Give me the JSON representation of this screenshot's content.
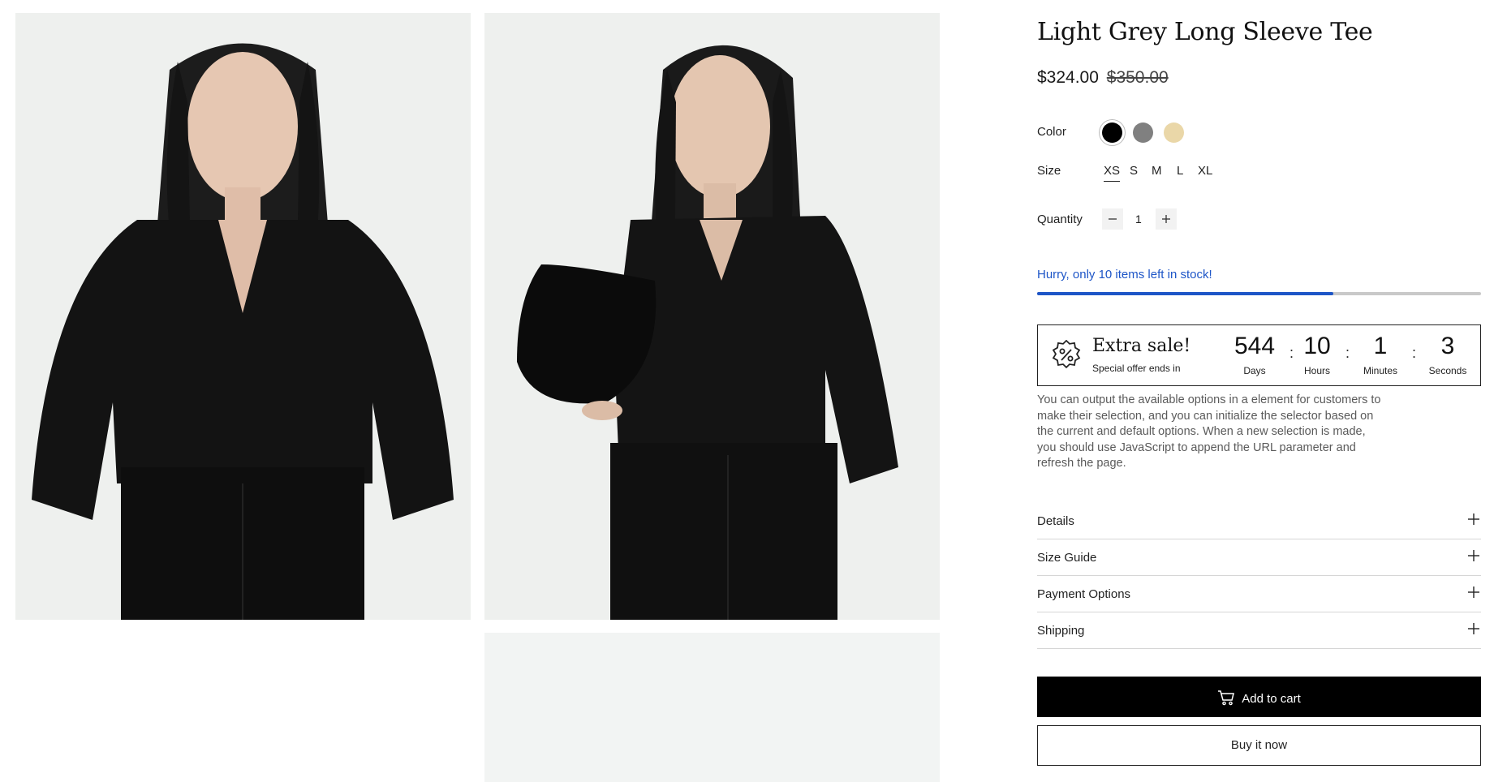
{
  "product": {
    "title": "Light Grey Long Sleeve Tee",
    "price": "$324.00",
    "compare_price": "$350.00"
  },
  "gallery": {
    "images": [
      {
        "name": "model-front-photo"
      },
      {
        "name": "model-bag-photo"
      },
      {
        "name": "product-detail-photo"
      }
    ]
  },
  "options": {
    "color_label": "Color",
    "colors": [
      {
        "name": "Black",
        "hex": "#000000",
        "selected": true
      },
      {
        "name": "Grey",
        "hex": "#808080",
        "selected": false
      },
      {
        "name": "Beige",
        "hex": "#ead7a8",
        "selected": false
      }
    ],
    "size_label": "Size",
    "sizes": [
      "XS",
      "S",
      "M",
      "L",
      "XL"
    ],
    "selected_size": "XS",
    "quantity_label": "Quantity",
    "quantity": "1",
    "decrement_icon": "minus-icon",
    "increment_icon": "plus-icon"
  },
  "stock": {
    "message": "Hurry, only 10 items left in stock!",
    "level": 0.667,
    "accent_color": "#1d55c7"
  },
  "sale": {
    "title": "Extra sale!",
    "subtitle": "Special offer ends in",
    "icon": "discount-badge-icon",
    "countdown": [
      {
        "value": "544",
        "label": "Days"
      },
      {
        "value": "10",
        "label": "Hours"
      },
      {
        "value": "1",
        "label": "Minutes"
      },
      {
        "value": "3",
        "label": "Seconds"
      }
    ],
    "separator": ":"
  },
  "description": "You can output the available options in a element for customers to make their selection, and you can initialize the selector based on the current and default options. When a new selection is made, you should use JavaScript to append the URL parameter and refresh the page.",
  "accordion": [
    {
      "label": "Details"
    },
    {
      "label": "Size Guide"
    },
    {
      "label": "Payment Options"
    },
    {
      "label": "Shipping"
    }
  ],
  "actions": {
    "add_to_cart": "Add to cart",
    "add_to_cart_icon": "cart-icon",
    "buy_now": "Buy it now"
  }
}
